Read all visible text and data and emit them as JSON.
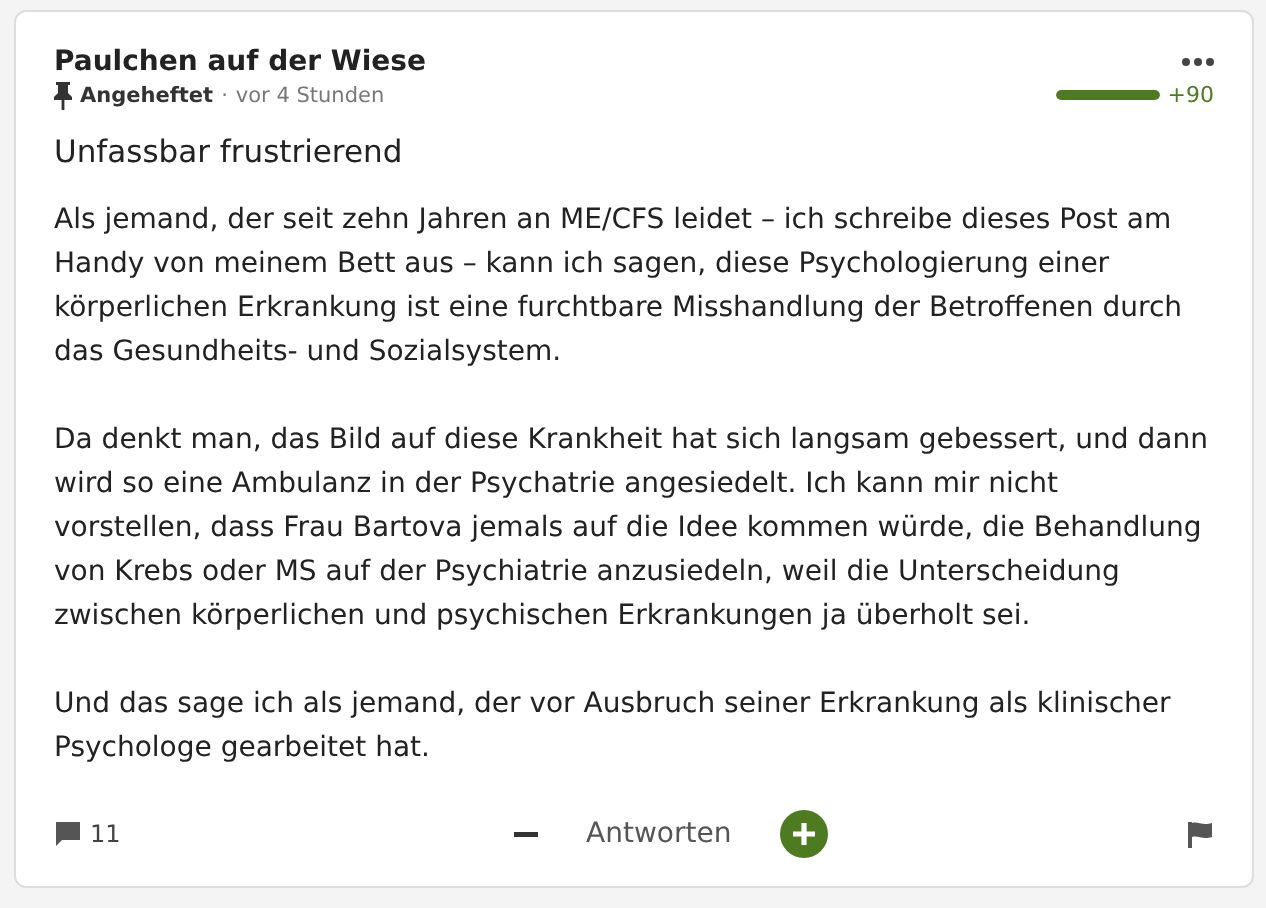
{
  "post": {
    "author": "Paulchen auf der Wiese",
    "pinned": true,
    "pinned_label": "Angeheftet",
    "separator": "·",
    "time": "vor 4 Stunden",
    "rating": {
      "level": 1,
      "score": "+90"
    },
    "title": "Unfassbar frustrierend",
    "paragraphs": [
      "Als jemand, der seit zehn Jahren an ME/CFS leidet – ich schreibe dieses Post am Handy von meinem Bett aus – kann ich sagen, diese Psychologierung einer körperlichen Erkrankung ist eine furchtbare Misshandlung der Betroffenen durch das Gesundheits- und Sozialsystem.",
      "Da denkt man, das Bild auf diese Krankheit hat sich langsam gebessert, und dann wird so eine Ambulanz in der Psychatrie angesiedelt. Ich kann mir nicht vorstellen, dass Frau Bartova jemals auf die Idee kommen würde, die Behandlung von Krebs oder MS auf der Psychiatrie anzusiedeln, weil die Unterscheidung zwischen körperlichen und psychischen Erkrankungen ja überholt sei.",
      "Und das sage ich als jemand, der vor Ausbruch seiner Erkrankung als klinischer Psychologe gearbeitet hat."
    ],
    "comments": "11",
    "reply": "Antworten"
  }
}
